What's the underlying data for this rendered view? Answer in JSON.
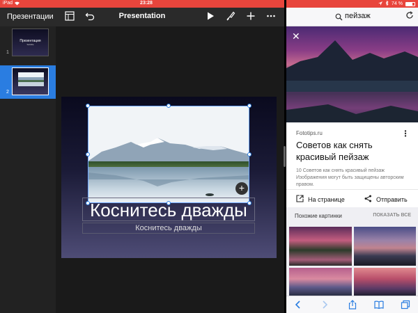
{
  "status": {
    "carrier": "iPad",
    "time": "23:28",
    "battery_text": "74 %",
    "battery_level": 0.74
  },
  "keynote": {
    "back_label": "Презентации",
    "title": "Presentation",
    "slides": [
      {
        "number": "1",
        "title": "Презентация",
        "subtitle": "Subtitle"
      },
      {
        "number": "2"
      }
    ],
    "slide": {
      "title": "Коснитесь дважды",
      "subtitle": "Коснитесь дважды"
    },
    "icons": [
      "slide-layout-icon",
      "undo-icon",
      "play-icon",
      "format-brush-icon",
      "plus-icon",
      "more-icon",
      "add-slide-icon"
    ]
  },
  "safari": {
    "query": "пейзаж",
    "card": {
      "source": "Fototips.ru",
      "title": "Советов как снять красивый пейзаж",
      "desc": "10 Советов как снять красивый пейзаж",
      "copyright": "Изображения могут быть защищены авторским правом.",
      "visit_label": "На странице",
      "share_label": "Отправить"
    },
    "related": {
      "title": "Похожие картинки",
      "show_all": "ПОКАЗАТЬ ВСЕ"
    }
  },
  "colors": {
    "status_bar": "#e8453c",
    "selection": "#2a7de1",
    "ios_blue": "#2a7de1"
  }
}
